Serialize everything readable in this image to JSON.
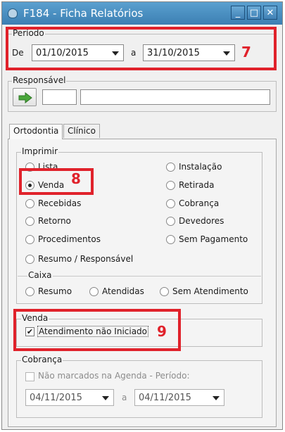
{
  "window": {
    "title": "F184 - Ficha Relatórios",
    "controls": {
      "minimize": "_",
      "maximize": "□",
      "close": "✕"
    }
  },
  "annotations": {
    "n7": "7",
    "n8": "8",
    "n9": "9",
    "color": "#e0222b"
  },
  "periodo": {
    "label": "Período",
    "de_label": "De",
    "from": "01/10/2015",
    "a_label": "a",
    "to": "31/10/2015"
  },
  "responsavel": {
    "label": "Responsável",
    "code": "",
    "name": ""
  },
  "tabs": [
    {
      "label": "Ortodontia",
      "active": true
    },
    {
      "label": "Clínico",
      "active": false
    }
  ],
  "imprimir": {
    "label": "Imprimir",
    "left": [
      {
        "label": "Lista",
        "selected": false
      },
      {
        "label": "Venda",
        "selected": true
      },
      {
        "label": "Recebidas",
        "selected": false
      },
      {
        "label": "Retorno",
        "selected": false
      },
      {
        "label": "Procedimentos",
        "selected": false
      },
      {
        "label": "Resumo / Responsável",
        "selected": false
      }
    ],
    "right": [
      {
        "label": "Instalação",
        "selected": false
      },
      {
        "label": "Retirada",
        "selected": false
      },
      {
        "label": "Cobrança",
        "selected": false
      },
      {
        "label": "Devedores",
        "selected": false
      },
      {
        "label": "Sem Pagamento",
        "selected": false
      }
    ]
  },
  "caixa": {
    "label": "Caixa",
    "options": [
      {
        "label": "Resumo",
        "selected": false
      },
      {
        "label": "Atendidas",
        "selected": false
      },
      {
        "label": "Sem Atendimento",
        "selected": false
      }
    ]
  },
  "venda": {
    "label": "Venda",
    "checkbox_label": "Atendimento não Iniciado",
    "checked": true,
    "check_mark": "✔"
  },
  "cobranca": {
    "label": "Cobrança",
    "checkbox_label": "Não marcados na Agenda - Período:",
    "checked": false,
    "from": "04/11/2015",
    "a_label": "a",
    "to": "04/11/2015"
  }
}
